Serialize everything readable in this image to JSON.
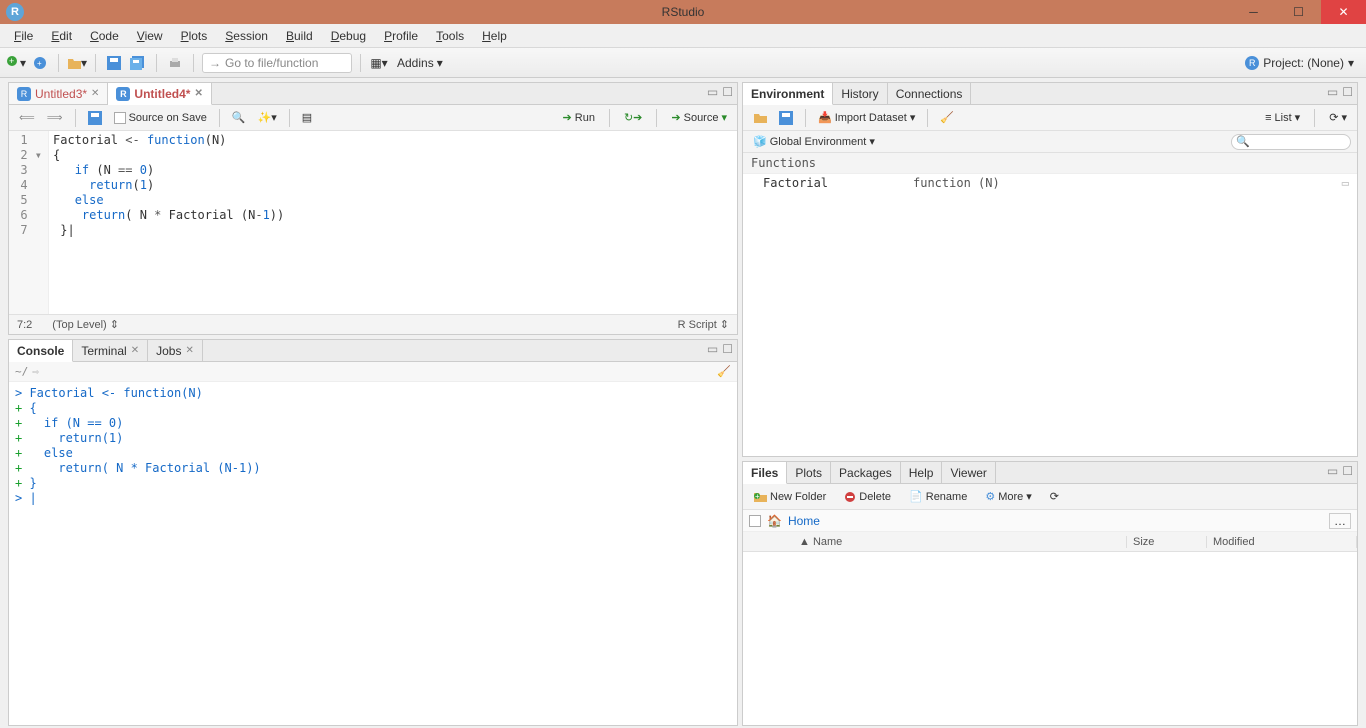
{
  "title": "RStudio",
  "menu": [
    "File",
    "Edit",
    "Code",
    "View",
    "Plots",
    "Session",
    "Build",
    "Debug",
    "Profile",
    "Tools",
    "Help"
  ],
  "toolbar": {
    "gotofile_placeholder": "Go to file/function",
    "addins": "Addins",
    "project_label": "Project: (None)"
  },
  "source": {
    "tabs": [
      {
        "label": "Untitled3*",
        "active": false
      },
      {
        "label": "Untitled4*",
        "active": true
      }
    ],
    "source_on_save": "Source on Save",
    "run": "Run",
    "source_btn": "Source",
    "cursor": "7:2",
    "scope": "(Top Level)",
    "mode": "R Script",
    "lines": [
      "1",
      "2",
      "3",
      "4",
      "5",
      "6",
      "7"
    ],
    "fold_marker_line": 2,
    "code_html": "Factorial <span class='op'>&lt;-</span> <span class='kw'>function</span>(N)\n{\n   <span class='kw'>if</span> (N <span class='op'>==</span> <span class='nm'>0</span>)\n     <span class='kw'>return</span>(<span class='nm'>1</span>)\n   <span class='kw'>else</span>\n    <span class='kw'>return</span>( N <span class='op'>*</span> Factorial (N<span class='op'>-</span><span class='nm'>1</span>))\n }|"
  },
  "console_tabs": [
    {
      "label": "Console",
      "active": true,
      "closable": false
    },
    {
      "label": "Terminal",
      "active": false,
      "closable": true
    },
    {
      "label": "Jobs",
      "active": false,
      "closable": true
    }
  ],
  "console": {
    "path": "~/",
    "lines": [
      {
        "p": ">",
        "t": " Factorial <- function(N)"
      },
      {
        "p": "+",
        "t": " {"
      },
      {
        "p": "+",
        "t": "   if (N == 0)"
      },
      {
        "p": "+",
        "t": "     return(1)"
      },
      {
        "p": "+",
        "t": "   else"
      },
      {
        "p": "+",
        "t": "     return( N * Factorial (N-1))"
      },
      {
        "p": "+",
        "t": " }"
      },
      {
        "p": ">",
        "t": " |"
      }
    ]
  },
  "env_tabs": [
    "Environment",
    "History",
    "Connections"
  ],
  "env": {
    "import": "Import Dataset",
    "scope": "Global Environment",
    "list_mode": "List",
    "section": "Functions",
    "items": [
      {
        "name": "Factorial",
        "value": "function (N)"
      }
    ]
  },
  "files_tabs": [
    "Files",
    "Plots",
    "Packages",
    "Help",
    "Viewer"
  ],
  "files": {
    "new_folder": "New Folder",
    "delete": "Delete",
    "rename": "Rename",
    "more": "More",
    "home": "Home",
    "cols": {
      "name": "Name",
      "size": "Size",
      "modified": "Modified"
    }
  }
}
